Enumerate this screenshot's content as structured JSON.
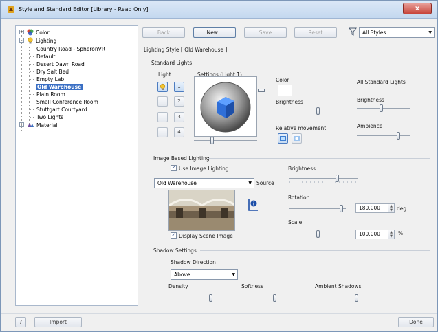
{
  "window": {
    "title": "Style and Standard Editor [Library - Read Only]",
    "close_label": "x"
  },
  "tree": {
    "items": [
      {
        "label": "Color",
        "expander": "+"
      },
      {
        "label": "Lighting",
        "expander": "-"
      },
      {
        "label": "Country Road - SpheronVR"
      },
      {
        "label": "Default"
      },
      {
        "label": "Desert Dawn Road"
      },
      {
        "label": "Dry Salt Bed"
      },
      {
        "label": "Empty Lab"
      },
      {
        "label": "Old Warehouse"
      },
      {
        "label": "Plain Room"
      },
      {
        "label": "Small Conference Room"
      },
      {
        "label": "Stuttgart Courtyard"
      },
      {
        "label": "Two Lights"
      },
      {
        "label": "Material",
        "expander": "+"
      }
    ]
  },
  "toolbar": {
    "back": "Back",
    "new": "New...",
    "save": "Save",
    "reset": "Reset",
    "filter_value": "All Styles"
  },
  "style_header": "Lighting Style [ Old Warehouse ]",
  "standard_lights": {
    "section": "Standard Lights",
    "light_label": "Light",
    "settings_label": "Settings (Light 1)",
    "lights": [
      "1",
      "2",
      "3",
      "4"
    ],
    "color_label": "Color",
    "brightness_label": "Brightness",
    "relative_movement_label": "Relative movement",
    "all_standard_lights_label": "All Standard Lights",
    "all_brightness_label": "Brightness",
    "ambience_label": "Ambience",
    "brightness_level": 0.8,
    "all_brightness_level": 0.45,
    "ambience_level": 0.8
  },
  "image_based_lighting": {
    "section": "Image Based Lighting",
    "use_image_lighting": "Use Image Lighting",
    "source_value": "Old Warehouse",
    "source_label": "Source",
    "brightness_label": "Brightness",
    "rotation_label": "Rotation",
    "rotation_value": "180.000",
    "rotation_unit": "deg",
    "scale_label": "Scale",
    "scale_value": "100.000",
    "scale_unit": "%",
    "display_scene_image": "Display Scene Image",
    "brightness_level": 0.7,
    "rotation_level": 0.95,
    "scale_level": 0.5
  },
  "shadow_settings": {
    "section": "Shadow Settings",
    "direction_label": "Shadow Direction",
    "direction_value": "Above",
    "density_label": "Density",
    "softness_label": "Softness",
    "ambient_shadows_label": "Ambient Shadows",
    "density_level": 0.9,
    "softness_level": 0.6,
    "ambient_level": 0.6
  },
  "footer": {
    "help": "?",
    "import": "Import",
    "done": "Done"
  },
  "colors": {
    "selected": "#3a6fc4",
    "title_bar": "#c4d8ef",
    "close": "#c7443a"
  }
}
